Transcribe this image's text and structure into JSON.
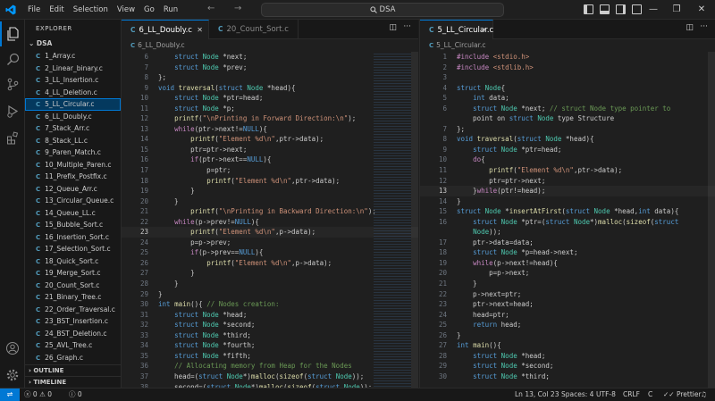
{
  "menu": [
    "File",
    "Edit",
    "Selection",
    "View",
    "Go",
    "Run"
  ],
  "command_center": "DSA",
  "sidebar": {
    "title": "EXPLORER",
    "folder": "DSA",
    "files": [
      "1_Array.c",
      "2_Linear_binary.c",
      "3_LL_Insertion.c",
      "4_LL_Deletion.c",
      "5_LL_Circular.c",
      "6_LL_Doubly.c",
      "7_Stack_Arr.c",
      "8_Stack_LL.c",
      "9_Paren_Match.c",
      "10_Multiple_Paren.c",
      "11_Prefix_Postfix.c",
      "12_Queue_Arr.c",
      "13_Circular_Queue.c",
      "14_Queue_LL.c",
      "15_Bubble_Sort.c",
      "16_Insertion_Sort.c",
      "17_Selection_Sort.c",
      "18_Quick_Sort.c",
      "19_Merge_Sort.c",
      "20_Count_Sort.c",
      "21_Binary_Tree.c",
      "22_Order_Traversal.c",
      "23_BST_Insertion.c",
      "24_BST_Deletion.c",
      "25_AVL_Tree.c",
      "26_Graph.c"
    ],
    "file_type_label": "C",
    "outline": "OUTLINE",
    "timeline": "TIMELINE"
  },
  "left_editor": {
    "tabs": [
      "6_LL_Doubly.c",
      "20_Count_Sort.c"
    ],
    "breadcrumb": "6_LL_Doubly.c",
    "current_line": "23",
    "lines": [
      {
        "n": "6",
        "t": "    struct Node *next;"
      },
      {
        "n": "7",
        "t": "    struct Node *prev;"
      },
      {
        "n": "8",
        "t": "};"
      },
      {
        "n": "9",
        "t": "void traversal(struct Node *head){"
      },
      {
        "n": "10",
        "t": "    struct Node *ptr=head;"
      },
      {
        "n": "11",
        "t": "    struct Node *p;"
      },
      {
        "n": "12",
        "t": "    printf(\"\\nPrinting in Forward Direction:\\n\");"
      },
      {
        "n": "13",
        "t": "    while(ptr->next!=NULL){"
      },
      {
        "n": "14",
        "t": "        printf(\"Element %d\\n\",ptr->data);"
      },
      {
        "n": "15",
        "t": "        ptr=ptr->next;"
      },
      {
        "n": "16",
        "t": "        if(ptr->next==NULL){"
      },
      {
        "n": "17",
        "t": "            p=ptr;"
      },
      {
        "n": "18",
        "t": "            printf(\"Element %d\\n\",ptr->data);"
      },
      {
        "n": "19",
        "t": "        }"
      },
      {
        "n": "20",
        "t": "    }"
      },
      {
        "n": "21",
        "t": "        printf(\"\\nPrinting in Backward Direction:\\n\");"
      },
      {
        "n": "22",
        "t": "    while(p->prev!=NULL){"
      },
      {
        "n": "23",
        "t": "        printf(\"Element %d\\n\",p->data);"
      },
      {
        "n": "24",
        "t": "        p=p->prev;"
      },
      {
        "n": "25",
        "t": "        if(p->prev==NULL){"
      },
      {
        "n": "26",
        "t": "            printf(\"Element %d\\n\",p->data);"
      },
      {
        "n": "27",
        "t": "        }"
      },
      {
        "n": "28",
        "t": "    }"
      },
      {
        "n": "29",
        "t": "}"
      },
      {
        "n": "30",
        "t": "int main(){ // Nodes creation:"
      },
      {
        "n": "31",
        "t": "    struct Node *head;"
      },
      {
        "n": "32",
        "t": "    struct Node *second;"
      },
      {
        "n": "33",
        "t": "    struct Node *third;"
      },
      {
        "n": "34",
        "t": "    struct Node *fourth;"
      },
      {
        "n": "35",
        "t": "    struct Node *fifth;"
      },
      {
        "n": "36",
        "t": "    // Allocating memory from Heap for the Nodes"
      },
      {
        "n": "37",
        "t": "    head=(struct Node*)malloc(sizeof(struct Node));"
      },
      {
        "n": "38",
        "t": "    second=(struct Node*)malloc(sizeof(struct Node));"
      }
    ]
  },
  "right_editor": {
    "tabs": [
      "5_LL_Circular.c"
    ],
    "breadcrumb": "5_LL_Circular.c",
    "current_line": "13",
    "lines": [
      {
        "n": "1",
        "t": "#include <stdio.h>"
      },
      {
        "n": "2",
        "t": "#include <stdlib.h>"
      },
      {
        "n": "3",
        "t": ""
      },
      {
        "n": "4",
        "t": "struct Node{"
      },
      {
        "n": "5",
        "t": "    int data;"
      },
      {
        "n": "6",
        "t": "    struct Node *next; // struct Node type pointer to"
      },
      {
        "n": "",
        "t": "    point on struct Node type Structure"
      },
      {
        "n": "7",
        "t": "};"
      },
      {
        "n": "8",
        "t": "void traversal(struct Node *head){"
      },
      {
        "n": "9",
        "t": "    struct Node *ptr=head;"
      },
      {
        "n": "10",
        "t": "    do{"
      },
      {
        "n": "11",
        "t": "        printf(\"Element %d\\n\",ptr->data);"
      },
      {
        "n": "12",
        "t": "        ptr=ptr->next;"
      },
      {
        "n": "13",
        "t": "    }while(ptr!=head);"
      },
      {
        "n": "14",
        "t": "}"
      },
      {
        "n": "15",
        "t": "struct Node *insertAtFirst(struct Node *head,int data){"
      },
      {
        "n": "16",
        "t": "    struct Node *ptr=(struct Node*)malloc(sizeof(struct"
      },
      {
        "n": "",
        "t": "    Node));"
      },
      {
        "n": "17",
        "t": "    ptr->data=data;"
      },
      {
        "n": "18",
        "t": "    struct Node *p=head->next;"
      },
      {
        "n": "19",
        "t": "    while(p->next!=head){"
      },
      {
        "n": "20",
        "t": "        p=p->next;"
      },
      {
        "n": "21",
        "t": "    }"
      },
      {
        "n": "22",
        "t": "    p->next=ptr;"
      },
      {
        "n": "23",
        "t": "    ptr->next=head;"
      },
      {
        "n": "24",
        "t": "    head=ptr;"
      },
      {
        "n": "25",
        "t": "    return head;"
      },
      {
        "n": "26",
        "t": "}"
      },
      {
        "n": "27",
        "t": "int main(){"
      },
      {
        "n": "28",
        "t": "    struct Node *head;"
      },
      {
        "n": "29",
        "t": "    struct Node *second;"
      },
      {
        "n": "30",
        "t": "    struct Node *third;"
      }
    ]
  },
  "statusbar": {
    "errors": "0",
    "warnings": "0",
    "info": "0",
    "position": "Ln 13, Col 23",
    "spaces": "Spaces: 4",
    "encoding": "UTF-8",
    "eol": "CRLF",
    "language": "C",
    "formatter": "Prettier"
  },
  "colors": {
    "accent": "#0078d4",
    "c_icon": "#519aba"
  }
}
